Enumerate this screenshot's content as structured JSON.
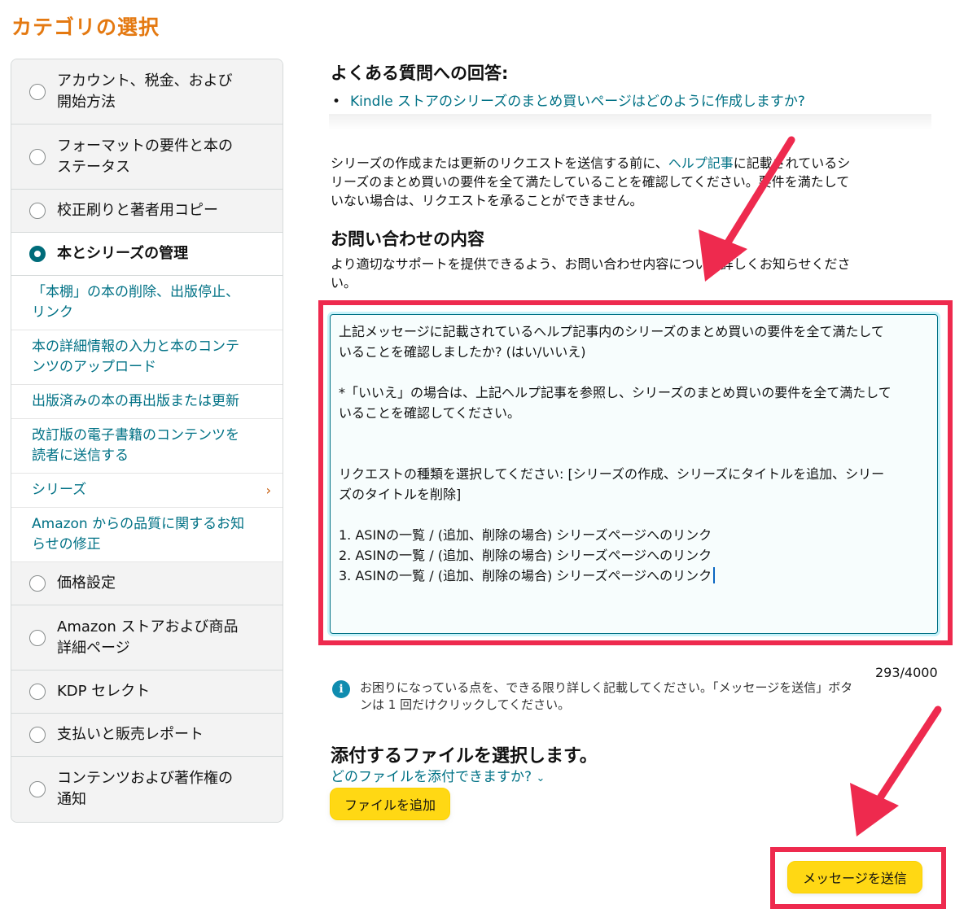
{
  "page_title": "カテゴリの選択",
  "sidebar": {
    "categories_top": [
      {
        "label_line1": "アカウント、税金、および",
        "label_line2": "開始方法"
      },
      {
        "label_line1": "フォーマットの要件と本の",
        "label_line2": "ステータス"
      },
      {
        "label_line1": "校正刷りと著者用コピー",
        "label_line2": ""
      }
    ],
    "active_category": "本とシリーズの管理",
    "subitems": [
      {
        "line1": "「本棚」の本の削除、出版停止、",
        "line2": "リンク"
      },
      {
        "line1": "本の詳細情報の入力と本のコンテ",
        "line2": "ンツのアップロード"
      },
      {
        "line1": "出版済みの本の再出版または更新",
        "line2": ""
      },
      {
        "line1": "改訂版の電子書籍のコンテンツを",
        "line2": "読者に送信する"
      },
      {
        "line1": "シリーズ",
        "line2": "",
        "chevron": "›"
      },
      {
        "line1": "Amazon からの品質に関するお知",
        "line2": "らせの修正"
      }
    ],
    "categories_bottom": [
      {
        "label_line1": "価格設定",
        "label_line2": ""
      },
      {
        "label_line1": "Amazon ストアおよび商品",
        "label_line2": "詳細ページ"
      },
      {
        "label_line1": "KDP セレクト",
        "label_line2": ""
      },
      {
        "label_line1": "支払いと販売レポート",
        "label_line2": ""
      },
      {
        "label_line1": "コンテンツおよび著作権の",
        "label_line2": "通知"
      }
    ]
  },
  "faq": {
    "heading": "よくある質問への回答:",
    "bullet": "•",
    "link": "Kindle ストアのシリーズのまとめ買いページはどのように作成しますか?"
  },
  "notice": {
    "before_link": "シリーズの作成または更新のリクエストを送信する前に、",
    "link": "ヘルプ記事",
    "after_link_line1": "に記載されているシ",
    "line2": "リーズのまとめ買いの要件を全て満たしていることを確認してください。要件を満たして",
    "line3": "いない場合は、リクエストを承ることができません。"
  },
  "inquiry": {
    "heading": "お問い合わせの内容",
    "desc_line1": "より適切なサポートを提供できるよう、お問い合わせ内容について詳しくお知らせくださ",
    "desc_line2": "い。",
    "message_lines": [
      "上記メッセージに記載されているヘルプ記事内のシリーズのまとめ買いの要件を全て満たして",
      "いることを確認しましたか? (はい/いいえ)",
      "",
      "*「いいえ」の場合は、上記ヘルプ記事を参照し、シリーズのまとめ買いの要件を全て満たして",
      "いることを確認してください。",
      "",
      "",
      "リクエストの種類を選択してください: [シリーズの作成、シリーズにタイトルを追加、シリー",
      "ズのタイトルを削除]",
      "",
      "1. ASINの一覧 / (追加、削除の場合) シリーズページへのリンク",
      "2. ASINの一覧 / (追加、削除の場合) シリーズページへのリンク",
      "3. ASINの一覧 / (追加、削除の場合) シリーズページへのリンク"
    ],
    "counter": "293/4000",
    "info_icon": "i",
    "info_line1": "お困りになっている点を、できる限り詳しく記載してください。「メッセージを送信」ボタ",
    "info_line2": "ンは 1 回だけクリックしてください。"
  },
  "attachments": {
    "heading": "添付するファイルを選択します。",
    "link": "どのファイルを添付できますか?",
    "link_chevron": "⌄",
    "add_button": "ファイルを追加"
  },
  "submit_button": "メッセージを送信",
  "colors": {
    "title": "#e47911",
    "link": "#007185",
    "highlight": "#ee2a4e",
    "button": "#ffd814",
    "radio_checked": "#006c7a"
  }
}
